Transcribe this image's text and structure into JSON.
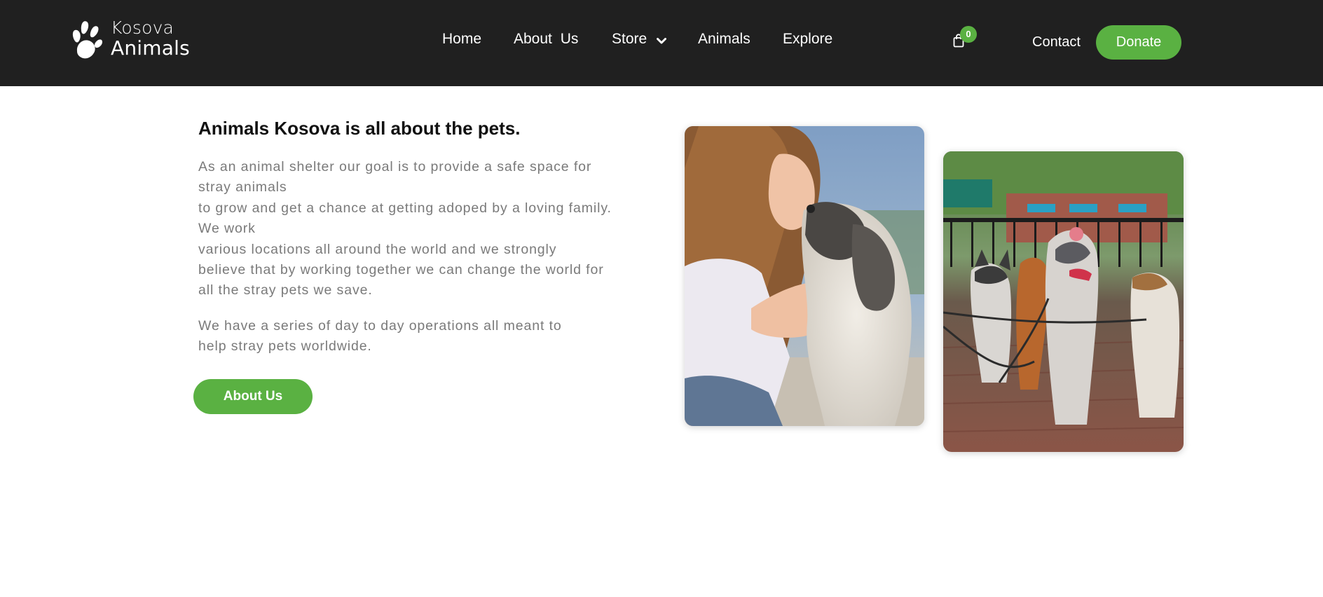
{
  "brand": {
    "line1": "Kosova",
    "line2": "Animals",
    "icon": "paw-icon"
  },
  "nav": {
    "home": "Home",
    "about": "About Us",
    "store": "Store",
    "animals": "Animals",
    "explore": "Explore"
  },
  "cart": {
    "icon": "shopping-bag-icon",
    "count": "0"
  },
  "header_actions": {
    "contact": "Contact",
    "donate": "Donate"
  },
  "main": {
    "headline": "Animals Kosova is all about the pets.",
    "paragraph1": [
      "As an animal shelter our goal is to provide a safe space for",
      "stray animals",
      "to grow and get a chance at getting adoped by a loving family.",
      "We work",
      "various locations all around the world and we strongly",
      "believe that by working together we can change the world for",
      "all the stray pets we save."
    ],
    "paragraph2": [
      "We have a series of day to day operations all meant to",
      "help stray pets worldwide."
    ],
    "about_button": "About Us"
  },
  "colors": {
    "header_bg": "#202020",
    "accent": "#5ab142",
    "body_text": "#7a7a7a",
    "headline": "#111111"
  }
}
